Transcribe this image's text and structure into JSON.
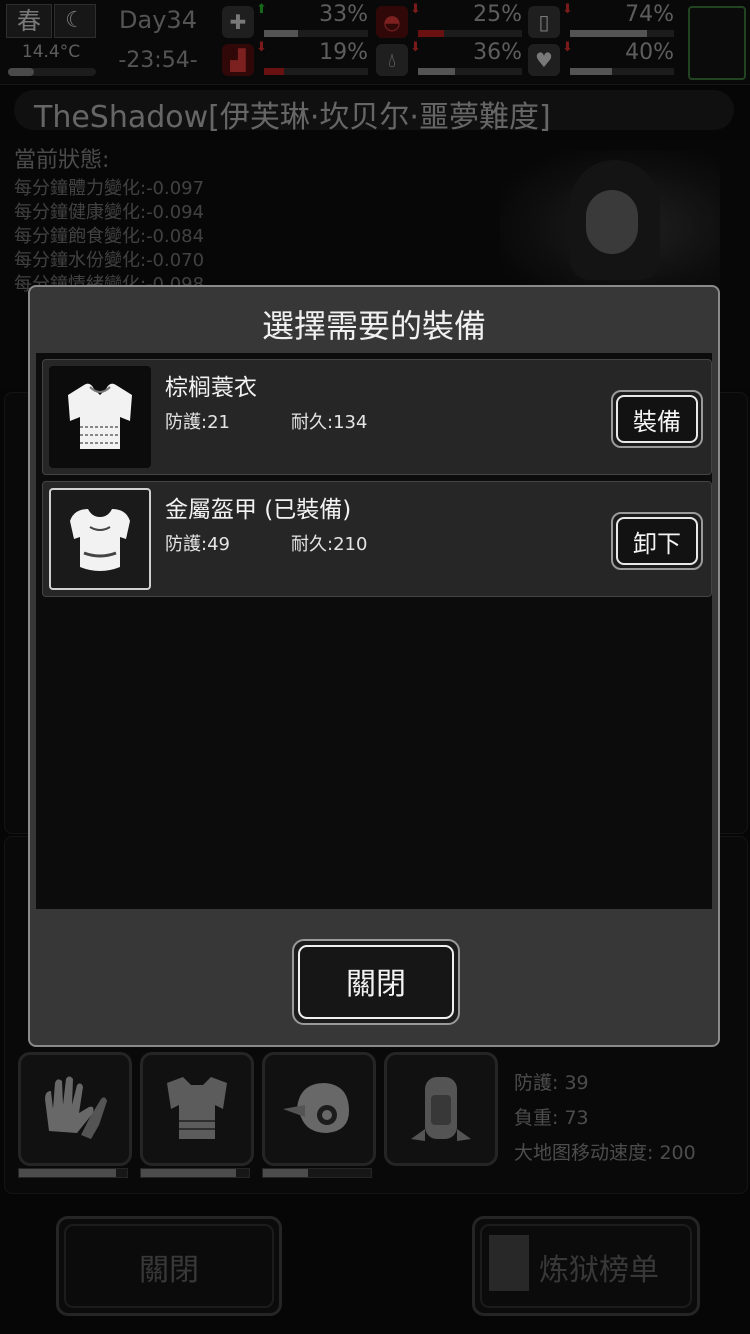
{
  "topbar": {
    "season": "春",
    "moon_icon": "crescent-moon-icon",
    "temperature": "14.4°C",
    "day": "Day34",
    "time": "-23:54-",
    "stats": [
      {
        "icon": "medkit-icon",
        "trend": "up",
        "percent": "33%",
        "level": 0.33
      },
      {
        "icon": "stomach-icon",
        "trend": "down",
        "percent": "25%",
        "level": 0.25,
        "alert": true
      },
      {
        "icon": "battery-icon",
        "trend": "down",
        "percent": "74%",
        "level": 0.74
      },
      {
        "icon": "boot-icon",
        "trend": "down",
        "percent": "19%",
        "level": 0.19,
        "alert": true
      },
      {
        "icon": "water-drop-icon",
        "trend": "down",
        "percent": "36%",
        "level": 0.36
      },
      {
        "icon": "heart-icon",
        "trend": "down",
        "percent": "40%",
        "level": 0.4
      }
    ]
  },
  "background": {
    "character_name": "TheShadow[伊芙琳·坎贝尔·噩夢難度]",
    "status_title": "當前狀態:",
    "status_lines": [
      "每分鐘體力變化:-0.097",
      "每分鐘健康變化:-0.094",
      "每分鐘飽食變化:-0.084",
      "每分鐘水份變化:-0.070",
      "每分鐘情緒變化:-0.098"
    ],
    "equipment_slots": [
      {
        "icon": "gloves-icon",
        "durability": 0.9
      },
      {
        "icon": "palm-raincoat-icon",
        "durability": 0.88
      },
      {
        "icon": "cap-icon",
        "durability": 0.42
      },
      {
        "icon": "backpack-icon",
        "durability": null
      }
    ],
    "equipment_stats": [
      "防護: 39",
      "負重: 73",
      "大地图移动速度: 200"
    ],
    "close_label": "關閉",
    "ranking_label": "炼狱榜单"
  },
  "modal": {
    "title": "選擇需要的裝備",
    "items": [
      {
        "name": "棕榈蓑衣",
        "defense": "防護:21",
        "durability": "耐久:134",
        "action": "裝備",
        "icon": "palm-raincoat-icon",
        "equipped": false
      },
      {
        "name": "金屬盔甲  (已裝備)",
        "defense": "防護:49",
        "durability": "耐久:210",
        "action": "卸下",
        "icon": "metal-armor-icon",
        "equipped": true
      }
    ],
    "close_label": "關閉"
  }
}
